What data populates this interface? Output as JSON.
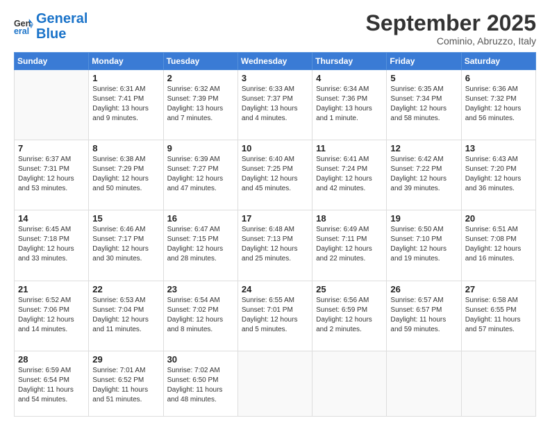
{
  "logo": {
    "general": "General",
    "blue": "Blue"
  },
  "header": {
    "month": "September 2025",
    "location": "Cominio, Abruzzo, Italy"
  },
  "weekdays": [
    "Sunday",
    "Monday",
    "Tuesday",
    "Wednesday",
    "Thursday",
    "Friday",
    "Saturday"
  ],
  "weeks": [
    [
      {
        "day": "",
        "empty": true
      },
      {
        "day": "1",
        "sunrise": "6:31 AM",
        "sunset": "7:41 PM",
        "daylight": "13 hours and 9 minutes."
      },
      {
        "day": "2",
        "sunrise": "6:32 AM",
        "sunset": "7:39 PM",
        "daylight": "13 hours and 7 minutes."
      },
      {
        "day": "3",
        "sunrise": "6:33 AM",
        "sunset": "7:37 PM",
        "daylight": "13 hours and 4 minutes."
      },
      {
        "day": "4",
        "sunrise": "6:34 AM",
        "sunset": "7:36 PM",
        "daylight": "13 hours and 1 minute."
      },
      {
        "day": "5",
        "sunrise": "6:35 AM",
        "sunset": "7:34 PM",
        "daylight": "12 hours and 58 minutes."
      },
      {
        "day": "6",
        "sunrise": "6:36 AM",
        "sunset": "7:32 PM",
        "daylight": "12 hours and 56 minutes."
      }
    ],
    [
      {
        "day": "7",
        "sunrise": "6:37 AM",
        "sunset": "7:31 PM",
        "daylight": "12 hours and 53 minutes."
      },
      {
        "day": "8",
        "sunrise": "6:38 AM",
        "sunset": "7:29 PM",
        "daylight": "12 hours and 50 minutes."
      },
      {
        "day": "9",
        "sunrise": "6:39 AM",
        "sunset": "7:27 PM",
        "daylight": "12 hours and 47 minutes."
      },
      {
        "day": "10",
        "sunrise": "6:40 AM",
        "sunset": "7:25 PM",
        "daylight": "12 hours and 45 minutes."
      },
      {
        "day": "11",
        "sunrise": "6:41 AM",
        "sunset": "7:24 PM",
        "daylight": "12 hours and 42 minutes."
      },
      {
        "day": "12",
        "sunrise": "6:42 AM",
        "sunset": "7:22 PM",
        "daylight": "12 hours and 39 minutes."
      },
      {
        "day": "13",
        "sunrise": "6:43 AM",
        "sunset": "7:20 PM",
        "daylight": "12 hours and 36 minutes."
      }
    ],
    [
      {
        "day": "14",
        "sunrise": "6:45 AM",
        "sunset": "7:18 PM",
        "daylight": "12 hours and 33 minutes."
      },
      {
        "day": "15",
        "sunrise": "6:46 AM",
        "sunset": "7:17 PM",
        "daylight": "12 hours and 30 minutes."
      },
      {
        "day": "16",
        "sunrise": "6:47 AM",
        "sunset": "7:15 PM",
        "daylight": "12 hours and 28 minutes."
      },
      {
        "day": "17",
        "sunrise": "6:48 AM",
        "sunset": "7:13 PM",
        "daylight": "12 hours and 25 minutes."
      },
      {
        "day": "18",
        "sunrise": "6:49 AM",
        "sunset": "7:11 PM",
        "daylight": "12 hours and 22 minutes."
      },
      {
        "day": "19",
        "sunrise": "6:50 AM",
        "sunset": "7:10 PM",
        "daylight": "12 hours and 19 minutes."
      },
      {
        "day": "20",
        "sunrise": "6:51 AM",
        "sunset": "7:08 PM",
        "daylight": "12 hours and 16 minutes."
      }
    ],
    [
      {
        "day": "21",
        "sunrise": "6:52 AM",
        "sunset": "7:06 PM",
        "daylight": "12 hours and 14 minutes."
      },
      {
        "day": "22",
        "sunrise": "6:53 AM",
        "sunset": "7:04 PM",
        "daylight": "12 hours and 11 minutes."
      },
      {
        "day": "23",
        "sunrise": "6:54 AM",
        "sunset": "7:02 PM",
        "daylight": "12 hours and 8 minutes."
      },
      {
        "day": "24",
        "sunrise": "6:55 AM",
        "sunset": "7:01 PM",
        "daylight": "12 hours and 5 minutes."
      },
      {
        "day": "25",
        "sunrise": "6:56 AM",
        "sunset": "6:59 PM",
        "daylight": "12 hours and 2 minutes."
      },
      {
        "day": "26",
        "sunrise": "6:57 AM",
        "sunset": "6:57 PM",
        "daylight": "11 hours and 59 minutes."
      },
      {
        "day": "27",
        "sunrise": "6:58 AM",
        "sunset": "6:55 PM",
        "daylight": "11 hours and 57 minutes."
      }
    ],
    [
      {
        "day": "28",
        "sunrise": "6:59 AM",
        "sunset": "6:54 PM",
        "daylight": "11 hours and 54 minutes."
      },
      {
        "day": "29",
        "sunrise": "7:01 AM",
        "sunset": "6:52 PM",
        "daylight": "11 hours and 51 minutes."
      },
      {
        "day": "30",
        "sunrise": "7:02 AM",
        "sunset": "6:50 PM",
        "daylight": "11 hours and 48 minutes."
      },
      {
        "day": "",
        "empty": true
      },
      {
        "day": "",
        "empty": true
      },
      {
        "day": "",
        "empty": true
      },
      {
        "day": "",
        "empty": true
      }
    ]
  ],
  "labels": {
    "sunrise": "Sunrise:",
    "sunset": "Sunset:",
    "daylight": "Daylight:"
  }
}
